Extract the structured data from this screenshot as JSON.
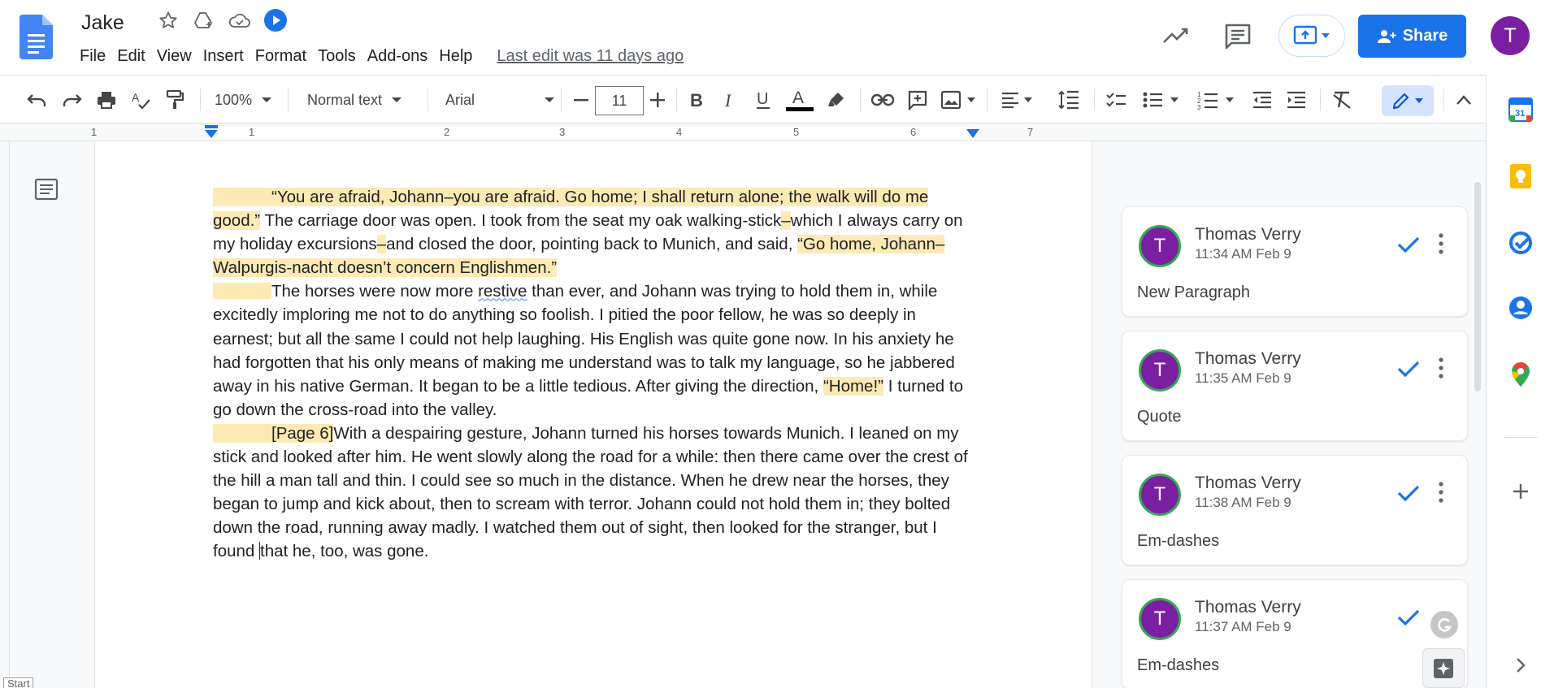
{
  "app": {
    "doc_title": "Jake",
    "last_edit": "Last edit was 11 days ago",
    "share_label": "Share",
    "user_initial": "T",
    "brand_color": "#1a73e8",
    "avatar_color": "#7b1fa2"
  },
  "menu": [
    "File",
    "Edit",
    "View",
    "Insert",
    "Format",
    "Tools",
    "Add-ons",
    "Help"
  ],
  "toolbar": {
    "zoom": "100%",
    "style": "Normal text",
    "font": "Arial",
    "font_size": "11",
    "icons": [
      "undo-icon",
      "redo-icon",
      "print-icon",
      "spellcheck-icon",
      "paint-format-icon",
      "bold-icon",
      "italic-icon",
      "underline-icon",
      "text-color-icon",
      "highlight-icon",
      "link-icon",
      "add-comment-icon",
      "image-icon",
      "align-icon",
      "line-spacing-icon",
      "checklist-icon",
      "bullet-list-icon",
      "numbered-list-icon",
      "decrease-indent-icon",
      "increase-indent-icon",
      "clear-format-icon",
      "editing-mode-icon",
      "collapse-icon"
    ]
  },
  "ruler": {
    "numbers": [
      "1",
      "1",
      "2",
      "3",
      "4",
      "5",
      "6",
      "7"
    ]
  },
  "document": {
    "p1_hl_a": "“You are afraid, Johann–you are afraid. Go home; I shall return alone; the walk will do me good.”",
    "p1_plain_a": " The carriage door was open. I took from the seat my oak walking-stick",
    "p1_dash_1": "–",
    "p1_plain_b": "which I always carry on my holiday excursions",
    "p1_dash_2": "–",
    "p1_plain_c": "and closed the door, pointing back to Munich, and said, ",
    "p1_hl_b": "“Go home, Johann–Walpurgis-nacht doesn’t concern Englishmen.”",
    "p2_a": "The horses were now more ",
    "p2_spell": "restive",
    "p2_b": " than ever, and Johann was trying to hold them in, while excitedly imploring me not to do anything so foolish. I pitied the poor fellow, he was so deeply in earnest; but all the same I could not help laughing. His English was quite gone now. In his anxiety he had forgotten that his only means of making me understand was to talk my language, so he jabbered away in his native German. It began to be a little tedious. After giving the direction, ",
    "p2_hl": "“Home!”",
    "p2_c": " I turned to go down the cross-road into the valley.",
    "p3_hl": "[Page 6]",
    "p3_a": "With a despairing gesture, Johann turned his horses towards Munich. I leaned on my stick and looked after him. He went slowly along the road for a while: then there came over the crest of the hill a man tall and thin. I could see so much in the distance. When he drew near the horses, they began to jump and kick about, then to scream with terror. Johann could not hold them in; they bolted down the road, running away madly. I watched them out of sight, then looked for the stranger, but I found ",
    "p3_b": "that he, too, was gone."
  },
  "comments": [
    {
      "initial": "T",
      "author": "Thomas Verry",
      "time": "11:34 AM Feb 9",
      "text": "New Paragraph"
    },
    {
      "initial": "T",
      "author": "Thomas Verry",
      "time": "11:35 AM Feb 9",
      "text": "Quote"
    },
    {
      "initial": "T",
      "author": "Thomas Verry",
      "time": "11:38 AM Feb 9",
      "text": "Em-dashes"
    },
    {
      "initial": "T",
      "author": "Thomas Verry",
      "time": "11:37 AM Feb 9",
      "text": "Em-dashes"
    }
  ],
  "sidepanel": {
    "icons": [
      "calendar-icon",
      "keep-icon",
      "tasks-icon",
      "contacts-icon",
      "maps-icon",
      "add-addon-icon",
      "expand-panel-icon"
    ],
    "calendar_day": "31"
  },
  "misc": {
    "start_tag": "Start"
  }
}
